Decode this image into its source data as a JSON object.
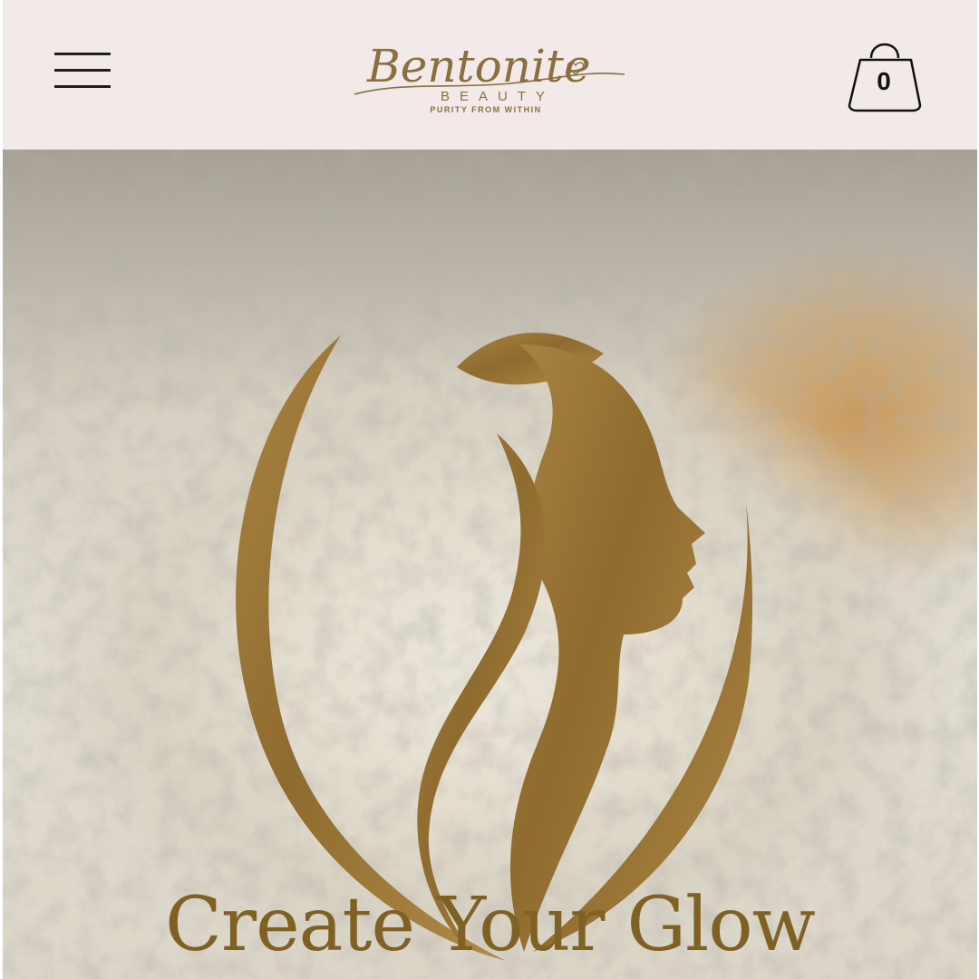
{
  "header": {
    "brand_script": "Bentonite",
    "brand_sub": "BEAUTY",
    "brand_tagline": "PURITY FROM WITHIN",
    "cart_count": "0"
  },
  "hero": {
    "title": "Create Your Glow"
  },
  "colors": {
    "header_bg": "#f2e9e9",
    "gold": "#9a7838",
    "title_gold": "#7f6124"
  },
  "icons": {
    "menu": "hamburger-icon",
    "cart": "shopping-bag-icon",
    "hero_logo": "woman-profile-leaf-icon"
  }
}
